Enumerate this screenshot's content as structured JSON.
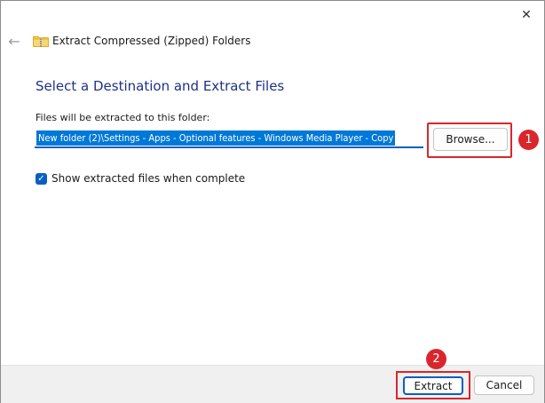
{
  "window": {
    "title": "Extract Compressed (Zipped) Folders",
    "close_glyph": "✕",
    "back_glyph": "←"
  },
  "main": {
    "heading": "Select a Destination and Extract Files",
    "path_label": "Files will be extracted to this folder:",
    "path_value": "New folder (2)\\Settings - Apps - Optional features - Windows Media Player - Copy",
    "browse_label": "Browse...",
    "show_files_label": "Show extracted files when complete",
    "show_files_checked": true,
    "check_glyph": "✓"
  },
  "footer": {
    "extract_label": "Extract",
    "cancel_label": "Cancel"
  },
  "annotations": {
    "badge_one": "1",
    "badge_two": "2"
  },
  "colors": {
    "accent": "#0a5fc2",
    "selection": "#0078d7",
    "heading": "#1e3287",
    "annotation_red": "#d9262c"
  },
  "icons": {
    "close": "close-icon",
    "back": "back-arrow-icon",
    "folder": "zipped-folder-icon",
    "check": "checkmark-icon"
  }
}
